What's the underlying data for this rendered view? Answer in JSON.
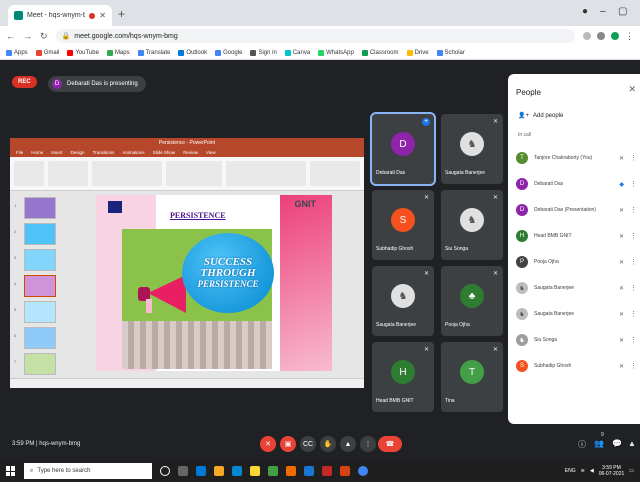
{
  "browser": {
    "tab_title": "Meet - hqs-wnym-bmg",
    "new_tab": "+",
    "window_controls": [
      "●",
      "–",
      "▢"
    ],
    "url": "meet.google.com/hqs-wnym-bmg",
    "bookmarks": [
      "Apps",
      "Gmail",
      "YouTube",
      "Maps",
      "Translate",
      "Outlook",
      "Google",
      "Sign in",
      "Canva",
      "WhatsApp",
      "Classroom",
      "Drive",
      "Scholar"
    ]
  },
  "meet": {
    "rec_label": "REC",
    "presenter_initial": "D",
    "presenting_text": "Debarati Das is presenting",
    "meeting_time": "3:59 PM",
    "meeting_code": "hqs-wnym-bmg",
    "info_separator": "|"
  },
  "ppt": {
    "window_title": "Persistence - PowerPoint",
    "menu": [
      "File",
      "Home",
      "Insert",
      "Design",
      "Transitions",
      "Animations",
      "Slide Show",
      "Review",
      "View"
    ],
    "thumb_numbers": [
      "1",
      "2",
      "3",
      "4",
      "5",
      "6",
      "7"
    ],
    "slide": {
      "heading": "PERSISTENCE",
      "brand": "GNIT",
      "bubble_lines": [
        "SUCCESS",
        "THROUGH",
        "PERSISTENCE"
      ]
    }
  },
  "tiles": [
    {
      "name": "Debarati Das",
      "initial": "D",
      "color": "#8e24aa",
      "mic": "✕",
      "pin": "+"
    },
    {
      "name": "Saugata Banerjee",
      "initial": "♞",
      "color": "#e0e0e0",
      "mic": "✕"
    },
    {
      "name": "Subhadip Ghosh",
      "initial": "S",
      "color": "#f4511e",
      "mic": "✕"
    },
    {
      "name": "Siu Songa",
      "initial": "♞",
      "color": "#e0e0e0",
      "mic": "✕"
    },
    {
      "name": "Saugata Banerjee",
      "initial": "♞",
      "color": "#e0e0e0",
      "mic": "✕"
    },
    {
      "name": "Pooja Ojha",
      "initial": "♣",
      "color": "#2e7d32",
      "mic": "✕"
    },
    {
      "name": "Head BMB GNIT",
      "initial": "H",
      "color": "#2e7d32",
      "mic": "✕"
    },
    {
      "name": "Tina",
      "initial": "T",
      "color": "#43a047",
      "mic": "✕"
    }
  ],
  "people_panel": {
    "title": "People",
    "close": "✕",
    "add_people": "Add people",
    "in_call": "In call",
    "people": [
      {
        "name": "Tanjore Chakraborty (You)",
        "initial": "T",
        "color": "#558b2f",
        "mic": "✕"
      },
      {
        "name": "Debarati Das",
        "initial": "D",
        "color": "#8e24aa",
        "mic": "◆"
      },
      {
        "name": "Debarati Das (Presentation)",
        "initial": "D",
        "color": "#8e24aa",
        "mic": "✕"
      },
      {
        "name": "Head BMB GNIT",
        "initial": "H",
        "color": "#2e7d32",
        "mic": "✕"
      },
      {
        "name": "Pooja Ojha",
        "initial": "P",
        "color": "#424242",
        "mic": "✕"
      },
      {
        "name": "Saugata Banerjee",
        "initial": "♞",
        "color": "#bdbdbd",
        "mic": "✕"
      },
      {
        "name": "Saugata Banerjee",
        "initial": "♞",
        "color": "#bdbdbd",
        "mic": "✕"
      },
      {
        "name": "Siu Songa",
        "initial": "♞",
        "color": "#9e9e9e",
        "mic": "✕"
      },
      {
        "name": "Subhadip Ghosh",
        "initial": "S",
        "color": "#f4511e",
        "mic": "✕"
      }
    ]
  },
  "controls": [
    {
      "name": "mic-off-button",
      "glyph": "✕",
      "color": "#ea4335"
    },
    {
      "name": "camera-off-button",
      "glyph": "▣",
      "color": "#ea4335"
    },
    {
      "name": "captions-button",
      "glyph": "CC",
      "color": "#3c4043"
    },
    {
      "name": "raise-hand-button",
      "glyph": "✋",
      "color": "#3c4043"
    },
    {
      "name": "present-button",
      "glyph": "▲",
      "color": "#3c4043"
    },
    {
      "name": "more-options-button",
      "glyph": "⋮",
      "color": "#3c4043"
    },
    {
      "name": "leave-call-button",
      "glyph": "☎",
      "color": "#ea4335"
    }
  ],
  "right_controls": [
    "ⓘ",
    "👥",
    "💬",
    "▲"
  ],
  "participant_count": "9",
  "taskbar": {
    "search_placeholder": "Type here to search",
    "tray_text": "ENG",
    "time": "3:59 PM",
    "date": "06-07-2021"
  }
}
